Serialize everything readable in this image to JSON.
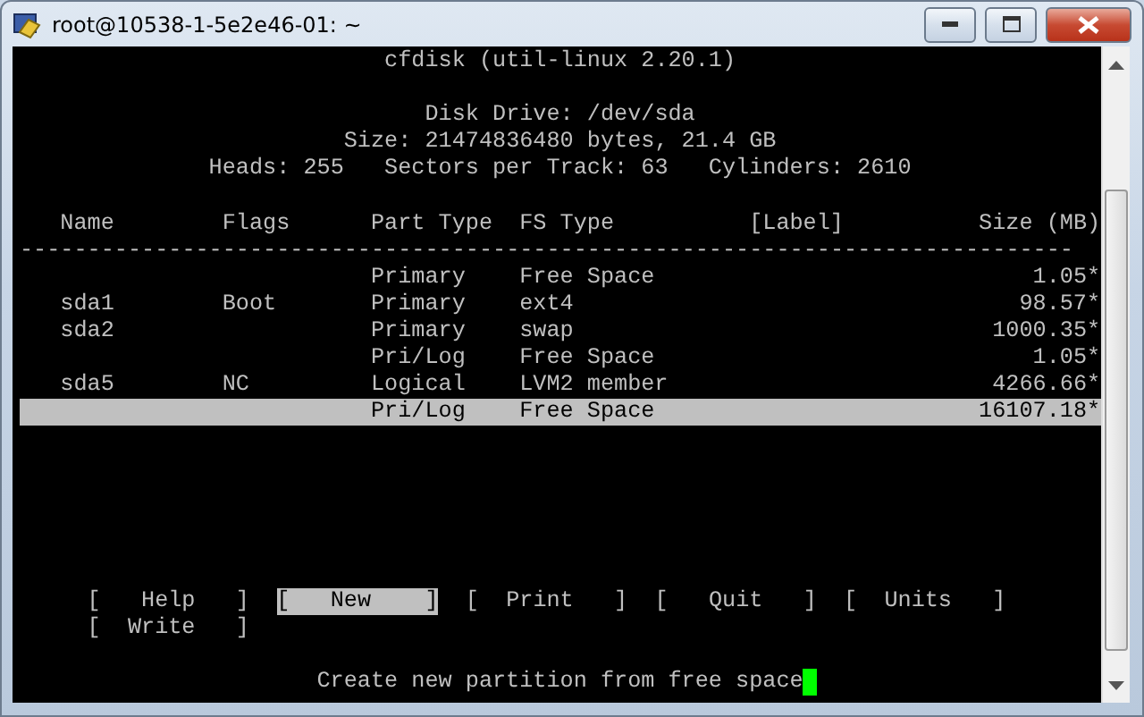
{
  "window": {
    "title": "root@10538-1-5e2e46-01: ~"
  },
  "header": [
    "cfdisk (util-linux 2.20.1)",
    "Disk Drive: /dev/sda",
    "Size: 21474836480 bytes, 21.4 GB",
    "Heads: 255   Sectors per Track: 63   Cylinders: 2610"
  ],
  "table": {
    "columns": [
      "Name",
      "Flags",
      "Part Type",
      "FS Type",
      "[Label]",
      "Size (MB)"
    ],
    "divider": "------------------------------------------------------------------------------",
    "rows": [
      {
        "part_type": "Primary",
        "fs_type": "Free Space",
        "size": "1.05*",
        "selected": false
      },
      {
        "name": "sda1",
        "flags": "Boot",
        "part_type": "Primary",
        "fs_type": "ext4",
        "size": "98.57*",
        "selected": false
      },
      {
        "name": "sda2",
        "part_type": "Primary",
        "fs_type": "swap",
        "size": "1000.35*",
        "selected": false
      },
      {
        "part_type": "Pri/Log",
        "fs_type": "Free Space",
        "size": "1.05*",
        "selected": false
      },
      {
        "name": "sda5",
        "flags": "NC",
        "part_type": "Logical",
        "fs_type": "LVM2 member",
        "size": "4266.66*",
        "selected": false
      },
      {
        "part_type": "Pri/Log",
        "fs_type": "Free Space",
        "size": "16107.18*",
        "selected": true
      }
    ]
  },
  "menu": [
    {
      "label": "[   Help   ]",
      "selected": false
    },
    {
      "label": "[   New    ]",
      "selected": true
    },
    {
      "label": "[  Print   ]",
      "selected": false
    },
    {
      "label": "[   Quit   ]",
      "selected": false
    },
    {
      "label": "[  Units   ]",
      "selected": false
    },
    {
      "label": "[  Write   ]",
      "selected": false
    }
  ],
  "status": "Create new partition from free space"
}
